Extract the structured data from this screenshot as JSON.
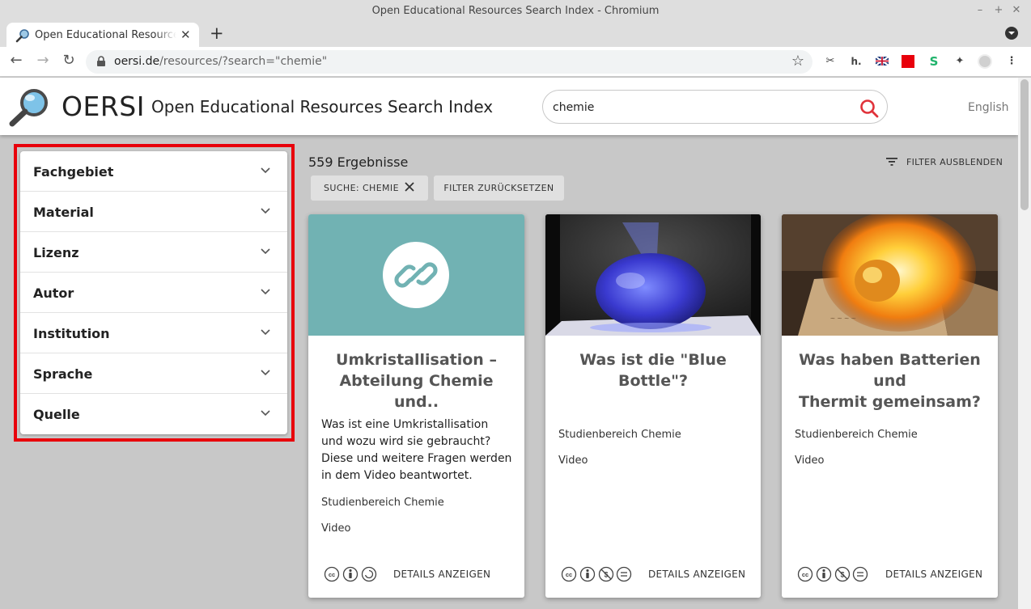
{
  "window": {
    "title": "Open Educational Resources Search Index - Chromium"
  },
  "tab": {
    "title": "Open Educational Resources Search Index - OERSI"
  },
  "address_bar": {
    "host": "oersi.de",
    "path": "/resources/?search=\"chemie\""
  },
  "site": {
    "brand": "OERSI",
    "subtitle": "Open Educational Resources Search Index",
    "search_value": "chemie",
    "language": "English"
  },
  "filters": [
    {
      "label": "Fachgebiet"
    },
    {
      "label": "Material"
    },
    {
      "label": "Lizenz"
    },
    {
      "label": "Autor"
    },
    {
      "label": "Institution"
    },
    {
      "label": "Sprache"
    },
    {
      "label": "Quelle"
    }
  ],
  "results": {
    "count_text": "559 Ergebnisse",
    "hide_filter_label": "FILTER AUSBLENDEN",
    "active_chip": "SUCHE: CHEMIE",
    "reset_label": "FILTER ZURÜCKSETZEN"
  },
  "cards": [
    {
      "title_line1": "Umkristallisation –",
      "title_line2": "Abteilung Chemie und..",
      "description": "Was ist eine Umkristallisation und wozu wird sie gebraucht? Diese und weitere Fragen werden in dem Video beantwortet.",
      "institution": "Studienbereich Chemie",
      "type": "Video",
      "licence": "CC BY SA",
      "details_label": "DETAILS ANZEIGEN",
      "media": "link-placeholder"
    },
    {
      "title_line1": "Was ist die \"Blue",
      "title_line2": "Bottle\"?",
      "description": "",
      "institution": "Studienbereich Chemie",
      "type": "Video",
      "licence": "CC BY NC ND",
      "details_label": "DETAILS ANZEIGEN",
      "media": "blue-flask-photo"
    },
    {
      "title_line1": "Was haben Batterien und",
      "title_line2": "Thermit gemeinsam?",
      "description": "",
      "institution": "Studienbereich Chemie",
      "type": "Video",
      "licence": "CC BY NC ND",
      "details_label": "DETAILS ANZEIGEN",
      "media": "fire-photo"
    }
  ],
  "colors": {
    "accent_red": "#e8000b",
    "teal_placeholder": "#71b2b3",
    "page_bg": "#c8c8c8",
    "search_icon": "#e0323a"
  }
}
